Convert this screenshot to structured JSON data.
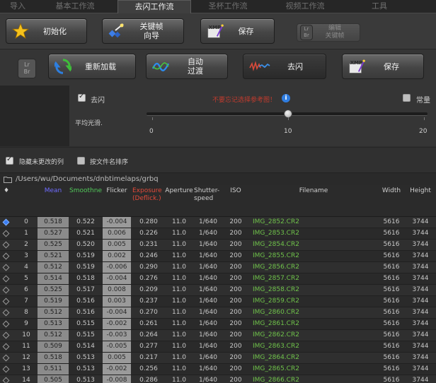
{
  "tabs": [
    {
      "label": "导入",
      "active": false
    },
    {
      "label": "基本工作流",
      "active": false
    },
    {
      "label": "去闪工作流",
      "active": true
    },
    {
      "label": "圣杯工作流",
      "active": false
    },
    {
      "label": "视频工作流",
      "active": false
    },
    {
      "label": "工具",
      "active": false
    }
  ],
  "toolbar1": {
    "init": "初始化",
    "keyframe_line1": "关键帧",
    "keyframe_line2": "向导",
    "save": "保存",
    "edit_line1": "编辑",
    "edit_line2": "关键帧",
    "lrbr_line1": "Lr",
    "lrbr_line2": "Br"
  },
  "toolbar2": {
    "lrbr_line1": "Lr",
    "lrbr_line2": "Br",
    "reload": "重新加载",
    "auto_line1": "自动",
    "auto_line2": "过渡",
    "deflicker": "去闪",
    "save": "保存"
  },
  "settings": {
    "deflicker_label": "去闪",
    "warning": "不要忘记选择参考图！",
    "info": "i",
    "normal_label": "常量",
    "smooth_label": "平均光滑.",
    "slider": {
      "min": "0",
      "mid": "10",
      "max": "20",
      "value": 10
    }
  },
  "options": {
    "hide_unchanged": "隐藏未更改的列",
    "sort_by_filename": "按文件名排序"
  },
  "path": "/Users/wu/Documents/dnbtimelaps/grbq",
  "colors": {
    "mean": "#6f6cff",
    "smooth": "#52c95a",
    "exposure": "#e34a3a",
    "filename": "#6fc24a",
    "selected": "#3a7df2"
  },
  "table": {
    "headers": {
      "dot": "♦",
      "mean": "Mean",
      "smooth": "Smoothne",
      "flicker": "Flicker",
      "exposure_line1": "Exposure",
      "exposure_line2": "(Deflick.)",
      "aperture": "Aperture",
      "shutter_line1": "Shutter-",
      "shutter_line2": "speed",
      "iso": "ISO",
      "filename": "Filename",
      "width": "Width",
      "height": "Height"
    },
    "rows": [
      {
        "idx": "0",
        "mean": "0.518",
        "smooth": "0.522",
        "flicker": "-0.004",
        "exp": "0.280",
        "ap": "11.0",
        "sh": "1/640",
        "iso": "200",
        "file": "IMG_2852.CR2",
        "w": "5616",
        "h": "3744"
      },
      {
        "idx": "1",
        "mean": "0.527",
        "smooth": "0.521",
        "flicker": "0.006",
        "exp": "0.226",
        "ap": "11.0",
        "sh": "1/640",
        "iso": "200",
        "file": "IMG_2853.CR2",
        "w": "5616",
        "h": "3744"
      },
      {
        "idx": "2",
        "mean": "0.525",
        "smooth": "0.520",
        "flicker": "0.005",
        "exp": "0.231",
        "ap": "11.0",
        "sh": "1/640",
        "iso": "200",
        "file": "IMG_2854.CR2",
        "w": "5616",
        "h": "3744"
      },
      {
        "idx": "3",
        "mean": "0.521",
        "smooth": "0.519",
        "flicker": "0.002",
        "exp": "0.246",
        "ap": "11.0",
        "sh": "1/640",
        "iso": "200",
        "file": "IMG_2855.CR2",
        "w": "5616",
        "h": "3744"
      },
      {
        "idx": "4",
        "mean": "0.512",
        "smooth": "0.519",
        "flicker": "-0.006",
        "exp": "0.290",
        "ap": "11.0",
        "sh": "1/640",
        "iso": "200",
        "file": "IMG_2856.CR2",
        "w": "5616",
        "h": "3744"
      },
      {
        "idx": "5",
        "mean": "0.514",
        "smooth": "0.518",
        "flicker": "-0.004",
        "exp": "0.276",
        "ap": "11.0",
        "sh": "1/640",
        "iso": "200",
        "file": "IMG_2857.CR2",
        "w": "5616",
        "h": "3744"
      },
      {
        "idx": "6",
        "mean": "0.525",
        "smooth": "0.517",
        "flicker": "0.008",
        "exp": "0.209",
        "ap": "11.0",
        "sh": "1/640",
        "iso": "200",
        "file": "IMG_2858.CR2",
        "w": "5616",
        "h": "3744"
      },
      {
        "idx": "7",
        "mean": "0.519",
        "smooth": "0.516",
        "flicker": "0.003",
        "exp": "0.237",
        "ap": "11.0",
        "sh": "1/640",
        "iso": "200",
        "file": "IMG_2859.CR2",
        "w": "5616",
        "h": "3744"
      },
      {
        "idx": "8",
        "mean": "0.512",
        "smooth": "0.516",
        "flicker": "-0.004",
        "exp": "0.270",
        "ap": "11.0",
        "sh": "1/640",
        "iso": "200",
        "file": "IMG_2860.CR2",
        "w": "5616",
        "h": "3744"
      },
      {
        "idx": "9",
        "mean": "0.513",
        "smooth": "0.515",
        "flicker": "-0.002",
        "exp": "0.261",
        "ap": "11.0",
        "sh": "1/640",
        "iso": "200",
        "file": "IMG_2861.CR2",
        "w": "5616",
        "h": "3744"
      },
      {
        "idx": "10",
        "mean": "0.512",
        "smooth": "0.515",
        "flicker": "-0.003",
        "exp": "0.264",
        "ap": "11.0",
        "sh": "1/640",
        "iso": "200",
        "file": "IMG_2862.CR2",
        "w": "5616",
        "h": "3744"
      },
      {
        "idx": "11",
        "mean": "0.509",
        "smooth": "0.514",
        "flicker": "-0.005",
        "exp": "0.277",
        "ap": "11.0",
        "sh": "1/640",
        "iso": "200",
        "file": "IMG_2863.CR2",
        "w": "5616",
        "h": "3744"
      },
      {
        "idx": "12",
        "mean": "0.518",
        "smooth": "0.513",
        "flicker": "0.005",
        "exp": "0.217",
        "ap": "11.0",
        "sh": "1/640",
        "iso": "200",
        "file": "IMG_2864.CR2",
        "w": "5616",
        "h": "3744"
      },
      {
        "idx": "13",
        "mean": "0.511",
        "smooth": "0.513",
        "flicker": "-0.002",
        "exp": "0.256",
        "ap": "11.0",
        "sh": "1/640",
        "iso": "200",
        "file": "IMG_2865.CR2",
        "w": "5616",
        "h": "3744"
      },
      {
        "idx": "14",
        "mean": "0.505",
        "smooth": "0.513",
        "flicker": "-0.008",
        "exp": "0.286",
        "ap": "11.0",
        "sh": "1/640",
        "iso": "200",
        "file": "IMG_2866.CR2",
        "w": "5616",
        "h": "3744"
      }
    ]
  }
}
